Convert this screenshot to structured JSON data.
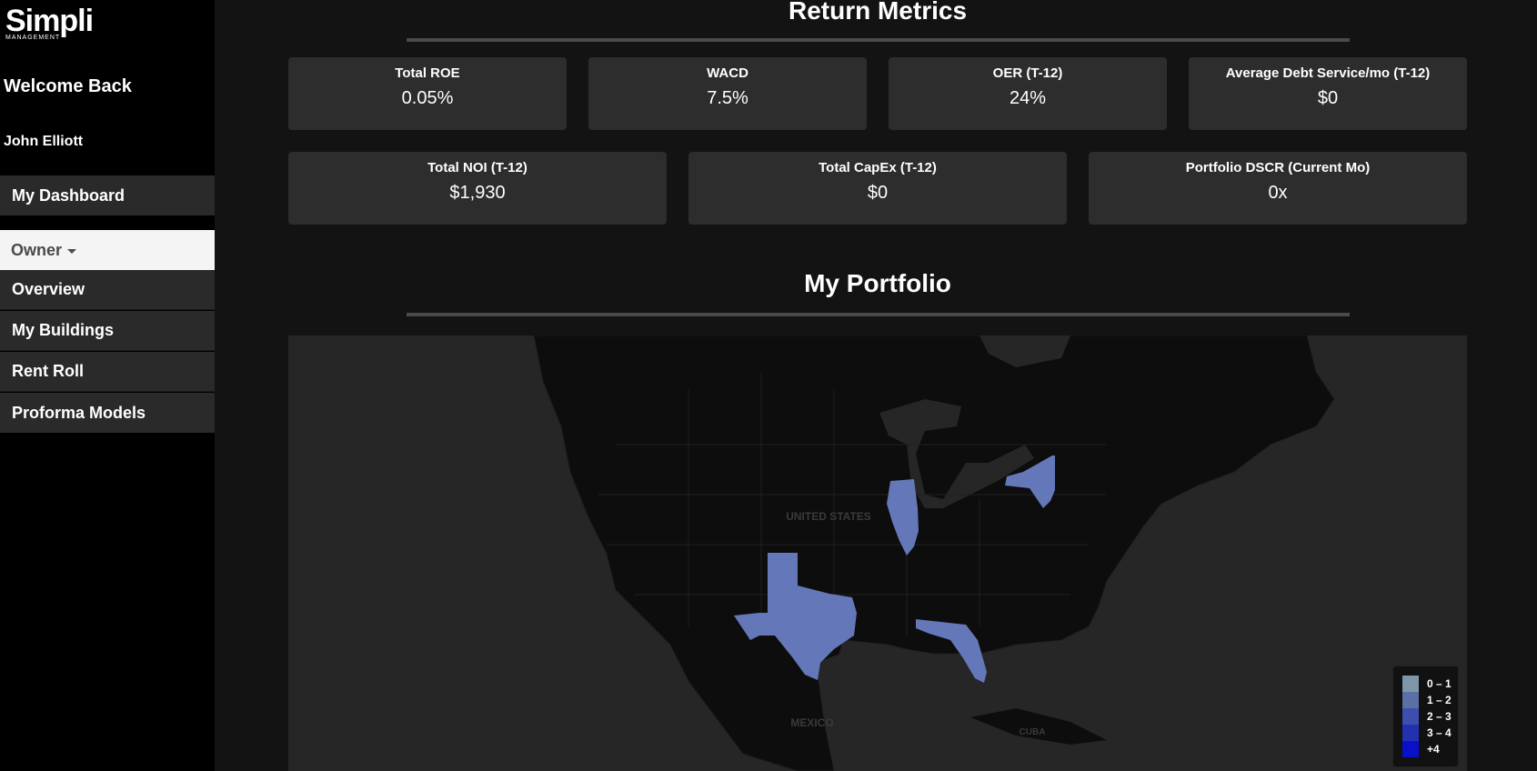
{
  "sidebar": {
    "logo": {
      "word": "Simpli",
      "sub": "MANAGEMENT"
    },
    "welcome": "Welcome Back",
    "user_name": "John Elliott",
    "dashboard": "My Dashboard",
    "owner_menu": "Owner",
    "items": [
      {
        "label": "Overview"
      },
      {
        "label": "My Buildings"
      },
      {
        "label": "Rent Roll"
      },
      {
        "label": "Proforma Models"
      }
    ]
  },
  "return_metrics": {
    "title": "Return Metrics",
    "row1": [
      {
        "label": "Total ROE",
        "value": "0.05%"
      },
      {
        "label": "WACD",
        "value": "7.5%"
      },
      {
        "label": "OER (T-12)",
        "value": "24%"
      },
      {
        "label": "Average Debt Service/mo (T-12)",
        "value": "$0"
      }
    ],
    "row2": [
      {
        "label": "Total NOI (T-12)",
        "value": "$1,930"
      },
      {
        "label": "Total CapEx (T-12)",
        "value": "$0"
      },
      {
        "label": "Portfolio DSCR (Current Mo)",
        "value": "0x"
      }
    ]
  },
  "portfolio": {
    "title": "My Portfolio",
    "map_labels": {
      "us": "UNITED STATES",
      "mexico": "MEXICO",
      "cuba": "CUBA"
    },
    "highlighted_states": [
      "New York",
      "Illinois",
      "Texas",
      "Florida"
    ],
    "highlight_color": "#6477b8",
    "legend": [
      {
        "label": "0 – 1",
        "color": "#7f96a8"
      },
      {
        "label": "1 – 2",
        "color": "#5a6fa6"
      },
      {
        "label": "2 – 3",
        "color": "#3d4fae"
      },
      {
        "label": "3 – 4",
        "color": "#2331b0"
      },
      {
        "label": "+4",
        "color": "#0a10c8"
      }
    ]
  }
}
